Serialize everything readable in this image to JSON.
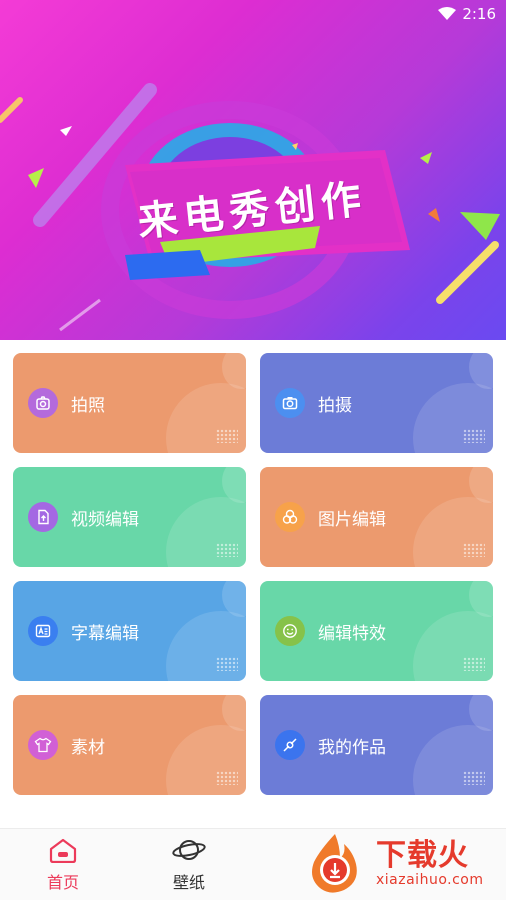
{
  "status_bar": {
    "time": "2:16"
  },
  "banner": {
    "title": "来电秀创作"
  },
  "features": [
    {
      "label": "拍照",
      "icon": "camera-plus-icon",
      "color": "orange",
      "icon_bg": "#b46adc"
    },
    {
      "label": "拍摄",
      "icon": "camera-icon",
      "color": "purple",
      "icon_bg": "#4c8ff0"
    },
    {
      "label": "视频编辑",
      "icon": "file-upload-icon",
      "color": "green",
      "icon_bg": "#a468e3"
    },
    {
      "label": "图片编辑",
      "icon": "circles-icon",
      "color": "orange",
      "icon_bg": "#f7a24a"
    },
    {
      "label": "字幕编辑",
      "icon": "text-box-icon",
      "color": "blue",
      "icon_bg": "#3a7ff0"
    },
    {
      "label": "编辑特效",
      "icon": "smile-icon",
      "color": "green",
      "icon_bg": "#86c24a"
    },
    {
      "label": "素材",
      "icon": "shirt-icon",
      "color": "orange",
      "icon_bg": "#d160d6"
    },
    {
      "label": "我的作品",
      "icon": "compass-icon",
      "color": "purple",
      "icon_bg": "#3b74ee"
    }
  ],
  "bottom_nav": {
    "items": [
      {
        "label": "首页",
        "icon": "home-icon",
        "active": true
      },
      {
        "label": "壁纸",
        "icon": "planet-icon",
        "active": false
      }
    ]
  },
  "watermark": {
    "title": "下载火",
    "site": "xiazaihuo.com"
  },
  "colors": {
    "accent": "#ec3a5a",
    "orange": "#ec9a6e",
    "purple": "#6c7cd7",
    "green": "#68d7a8",
    "blue": "#58a5e5"
  }
}
